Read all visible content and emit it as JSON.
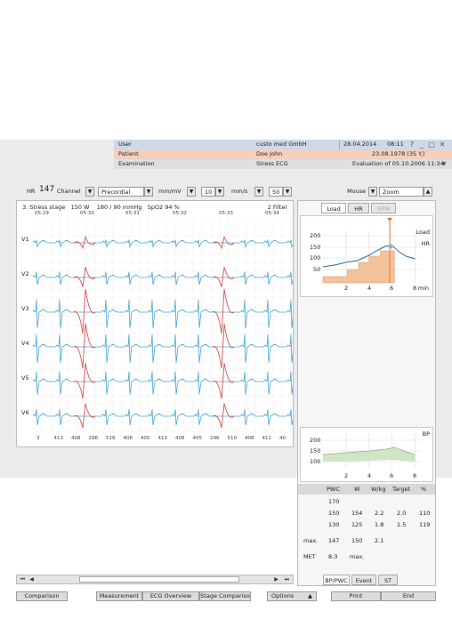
{
  "header": {
    "user_label": "User",
    "user_value": "custo med GmbH",
    "date": "28.04.2014",
    "time": "08:11",
    "patient_label": "Patient",
    "patient_value": "Doe John",
    "birth": "23.08.1978 (35 Y.)",
    "exam_label": "Examination",
    "exam_value": "Stress ECG",
    "evaluation": "Evaluation of  05.10.2006 11:34",
    "win_help": "?",
    "win_min": "_",
    "win_max": "□",
    "win_close": "✕",
    "dropdown_icon": "▼"
  },
  "toolbar": {
    "hr_label": "HR",
    "hr_value": "147",
    "channel_label": "Channel",
    "channel_value": "Precordial",
    "unit1": "mm/mV",
    "sens": "10",
    "unit2": "mm/s",
    "speed": "50",
    "mouse": "Mouse",
    "zoom": "Zoom",
    "arrow": "▼",
    "arrow_up": "▲"
  },
  "ecg": {
    "stage": "3. Stress stage",
    "watt": "150 W",
    "bp": "180 / 90 mmHg",
    "spo2": "SpO2 94 %",
    "filter": "2 Filter",
    "times": [
      "05:29",
      "05:30",
      "05:31",
      "05:32",
      "05:33",
      "05:34"
    ],
    "leads": [
      "V1",
      "V2",
      "V3",
      "V4",
      "V5",
      "V6"
    ],
    "bottom_values": [
      "3",
      "413",
      "408",
      "296",
      "518",
      "408",
      "405",
      "413",
      "408",
      "405",
      "296",
      "510",
      "408",
      "411",
      "40"
    ],
    "colors": {
      "normal": "#4aa6d6",
      "highlight": "#d9534f",
      "grid": "#eeeeee"
    }
  },
  "scroll": {
    "first": "⏮",
    "prev": "◀",
    "next": "▶",
    "last": "⏭"
  },
  "right_tabs": {
    "load": "Load",
    "hr": "HR",
    "rpm": "RPM"
  },
  "chart_hr": {
    "type": "area",
    "series_labels": [
      "Load",
      "HR"
    ],
    "y_ticks": [
      "200",
      "150",
      "100",
      "50"
    ],
    "x_ticks": [
      "2",
      "4",
      "6",
      "8"
    ],
    "x_unit": "min",
    "cursor_x": 5.8,
    "colors": {
      "load": "#f2c29a",
      "hr": "#2a6f99",
      "cursor": "#e8743b"
    }
  },
  "chart_bp": {
    "type": "area",
    "series_label": "BP",
    "y_ticks": [
      "200",
      "150",
      "100"
    ],
    "x_ticks": [
      "2",
      "4",
      "6",
      "8"
    ],
    "colors": {
      "fill": "#cfe5c3",
      "line": "#7a7a7a"
    }
  },
  "table": {
    "headers": [
      "PWC",
      "W",
      "W/kg",
      "Target",
      "%"
    ],
    "rows": [
      [
        "170",
        "",
        "",
        "",
        ""
      ],
      [
        "150",
        "154",
        "2.2",
        "2.0",
        "110"
      ],
      [
        "130",
        "125",
        "1.8",
        "1.5",
        "119"
      ]
    ],
    "max_label": "max.",
    "max_values": [
      "147",
      "150",
      "2.1"
    ],
    "met_label": "MET",
    "met_value": "8.3",
    "met_max": "max."
  },
  "bottom_tabs": {
    "bp": "BP/PWC",
    "event": "Event",
    "st": "ST"
  },
  "buttons": {
    "comparison": "Comparison",
    "measurement": "Measurement",
    "overview": "ECG Overview",
    "stage": "Stage Compariso",
    "options": "Options",
    "options_arrow": "▲",
    "print": "Print",
    "end": "End"
  }
}
